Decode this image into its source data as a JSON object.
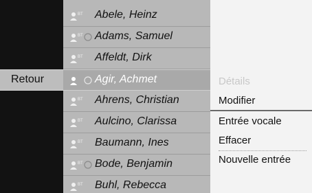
{
  "back_button": {
    "label": "Retour"
  },
  "contacts": [
    {
      "name": "Abele, Heinz",
      "icons": [
        "bluetooth-contact"
      ],
      "selected": false
    },
    {
      "name": "Adams, Samuel",
      "icons": [
        "bluetooth-contact",
        "navigation-destination"
      ],
      "selected": false
    },
    {
      "name": "Affeldt, Dirk",
      "icons": [
        "bluetooth-contact"
      ],
      "selected": false
    },
    {
      "name": "Agir, Achmet",
      "icons": [
        "contact",
        "navigation-destination"
      ],
      "selected": true
    },
    {
      "name": "Ahrens, Christian",
      "icons": [
        "bluetooth-contact"
      ],
      "selected": false
    },
    {
      "name": "Aulcino, Clarissa",
      "icons": [
        "bluetooth-contact"
      ],
      "selected": false
    },
    {
      "name": "Baumann, Ines",
      "icons": [
        "bluetooth-contact"
      ],
      "selected": false
    },
    {
      "name": "Bode, Benjamin",
      "icons": [
        "bluetooth-contact",
        "navigation-destination"
      ],
      "selected": false
    },
    {
      "name": "Buhl, Rebecca",
      "icons": [
        "bluetooth-contact"
      ],
      "selected": false
    }
  ],
  "menu": {
    "items": [
      {
        "label": "Détails",
        "state": "disabled"
      },
      {
        "label": "Modifier",
        "state": "active"
      },
      {
        "label": "Entrée vocale",
        "state": "normal"
      },
      {
        "label": "Effacer",
        "state": "normal"
      },
      {
        "label": "Nouvelle entrée",
        "state": "normal"
      }
    ]
  },
  "colors": {
    "list_bg": "#b8b8b8",
    "menu_bg": "#f3f3f3",
    "selected_text": "#ffffff",
    "disabled_text": "#c8c8c8"
  }
}
